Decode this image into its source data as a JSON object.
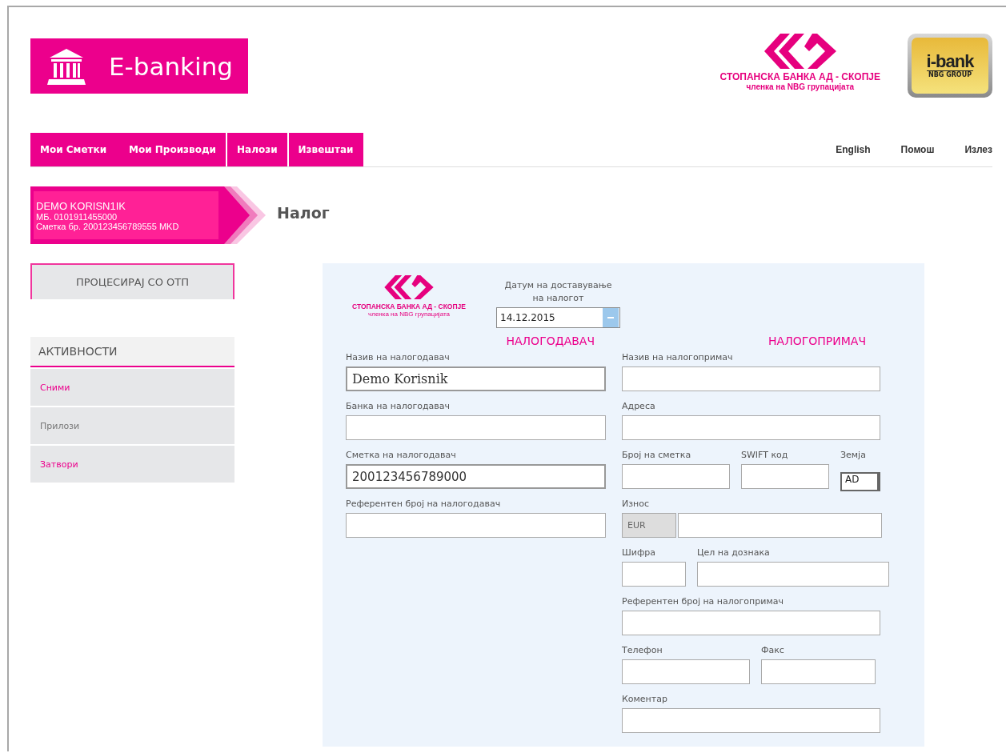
{
  "header": {
    "app_name": "E-banking",
    "bank_name": "СТОПАНСКА БАНКА АД - СКОПЈЕ",
    "bank_tagline": "членка на NBG групацијата",
    "badge_name": "i-bank",
    "badge_group": "NBG GROUP"
  },
  "nav": [
    {
      "items": [
        "Мои Сметки",
        "Мои Производи"
      ]
    },
    {
      "items": [
        "Налози"
      ]
    },
    {
      "items": [
        "Извештаи"
      ]
    }
  ],
  "top_links": [
    "English",
    "Помош",
    "Излез"
  ],
  "user": {
    "name": "DEMO KORISN1IK",
    "id_line": "МБ. 0101911455000",
    "account_line": "Сметка бр. 200123456789555 MKD"
  },
  "page_title": "Налог",
  "process_button": "ПРОЦЕСИРАЈ СО ОТП",
  "activities": {
    "title": "АКТИВНОСТИ",
    "items": [
      {
        "label": "Сними",
        "disabled": false
      },
      {
        "label": "Прилози",
        "disabled": true
      },
      {
        "label": "Затвори",
        "disabled": false
      }
    ]
  },
  "form": {
    "bank_name": "СТОПАНСКА БАНКА АД - СКОПЈЕ",
    "bank_tagline": "членка на NBG групацијата",
    "date_label": "Датум на доставување на налогот",
    "date_value": "14.12.2015",
    "payer_title": "НАЛОГОДАВАЧ",
    "payee_title": "НАЛОГОПРИМАЧ",
    "payer_fields": [
      {
        "label": "Назив на налогодавач",
        "value": "Demo Korisnik"
      },
      {
        "label": "Банка на налогодавач"
      },
      {
        "label": "Сметка на налогодавач",
        "value": "200123456789000"
      },
      {
        "label": "Референтен број на налогодавач"
      }
    ],
    "payee_rows": [
      [
        {
          "kind": "text",
          "label": "Назив на налогопримач"
        }
      ],
      [
        {
          "kind": "text",
          "label": "Адреса"
        }
      ],
      [
        {
          "kind": "text",
          "label": "Број на сметка"
        },
        {
          "kind": "text",
          "label": "SWIFT код"
        },
        {
          "kind": "select",
          "label": "Земја",
          "value": "AD"
        }
      ],
      [
        {
          "kind": "currency",
          "label": "Износ",
          "value": "EUR"
        }
      ],
      [
        {
          "kind": "text",
          "label": "Шифра"
        },
        {
          "kind": "text",
          "label": "Цел на дознака"
        }
      ],
      [
        {
          "kind": "text",
          "label": "Референтен број на налогопримач"
        }
      ],
      [
        {
          "kind": "text",
          "label": "Телефон"
        },
        {
          "kind": "text",
          "label": "Факс"
        }
      ],
      [
        {
          "kind": "text",
          "label": "Коментар"
        }
      ]
    ]
  }
}
